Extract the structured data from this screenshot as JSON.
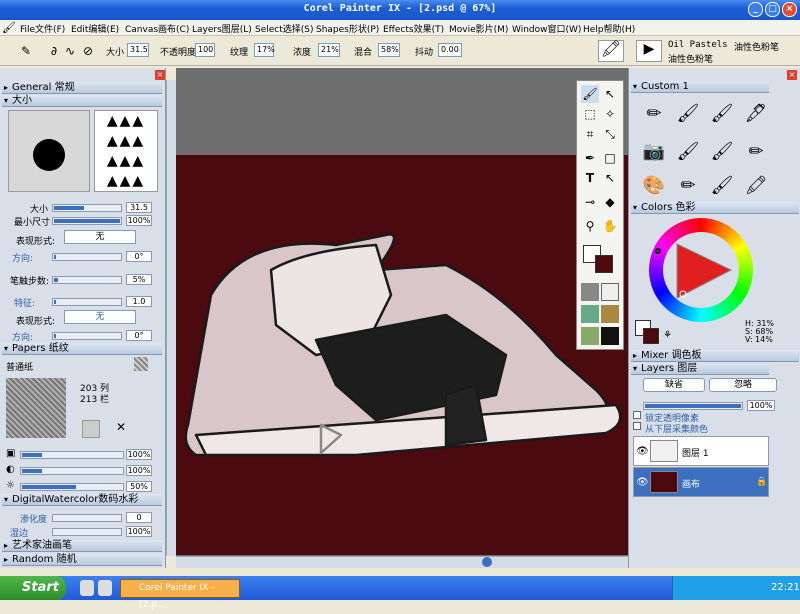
{
  "window": {
    "title": "Corel Painter IX - [2.psd @ 67%]"
  },
  "menu": [
    "File文件(F)",
    "Edit编辑(E)",
    "Canvas画布(C)",
    "Layers图层(L)",
    "Select选择(S)",
    "Shapes形状(P)",
    "Effects效果(T)",
    "Movie影片(M)",
    "Window窗口(W)",
    "Help帮助(H)"
  ],
  "props": {
    "size_label": "大小",
    "size": "31.5",
    "opacity_label": "不透明度",
    "opacity": "100",
    "grain_label": "纹理",
    "grain": "17%",
    "resat_label": "浓度",
    "resat": "21%",
    "bleed_label": "混合",
    "bleed": "58%",
    "jitter_label": "抖动",
    "jitter": "0.00",
    "brush_category": "Oil Pastels",
    "brush_variant": "油性色粉笔",
    "brush_variant2": "油性色粉笔"
  },
  "left": {
    "general": "General 常规",
    "size_section": "大小",
    "size_label": "大小",
    "size_value": "31.5",
    "minsize_label": "最小尺寸",
    "minsize_value": "100%",
    "expression_label": "表现形式:",
    "expression_value": "无",
    "direction_label": "方向:",
    "direction_value": "0°",
    "spacing_label": "笔触步数:",
    "spacing_value": "5%",
    "feature_label": "特征:",
    "feature_value": "1.0",
    "expression2_label": "表现形式:",
    "expression2_value": "无",
    "direction2_label": "方向:",
    "direction2_value": "0°",
    "papers": "Papers 纸纹",
    "paper_name": "普通纸",
    "paper_cols": "203 列",
    "paper_rows": "213 栏",
    "p1": "100%",
    "p2": "100%",
    "p3": "50%",
    "digital_wc": "DigitalWatercolor数码水彩",
    "wet_label": "渗化度",
    "wet_value": "0",
    "edge_label": "湿边",
    "edge_value": "100%",
    "artist_oils": "艺术家油画笔",
    "random": "Random 随机"
  },
  "right": {
    "custom": "Custom 1",
    "colors": "Colors 色彩",
    "hsv_h": "H: 31%",
    "hsv_s": "S: 68%",
    "hsv_v": "V: 14%",
    "mixer": "Mixer 调色板",
    "layers": "Layers 图层",
    "composite": "缺省",
    "method": "忽略",
    "opacity_value": "100%",
    "preserve": "锁定透明像素",
    "pick": "从下层采集颜色",
    "layer1": "图层 1",
    "canvas_layer": "画布"
  },
  "taskbar": {
    "start": "Start",
    "task": "Corel Painter IX - [2.p...",
    "clock": "22:21"
  },
  "colors": {
    "canvas_bg": "#4a0a10",
    "primary": "#ffffff",
    "secondary": "#4a0a10"
  }
}
